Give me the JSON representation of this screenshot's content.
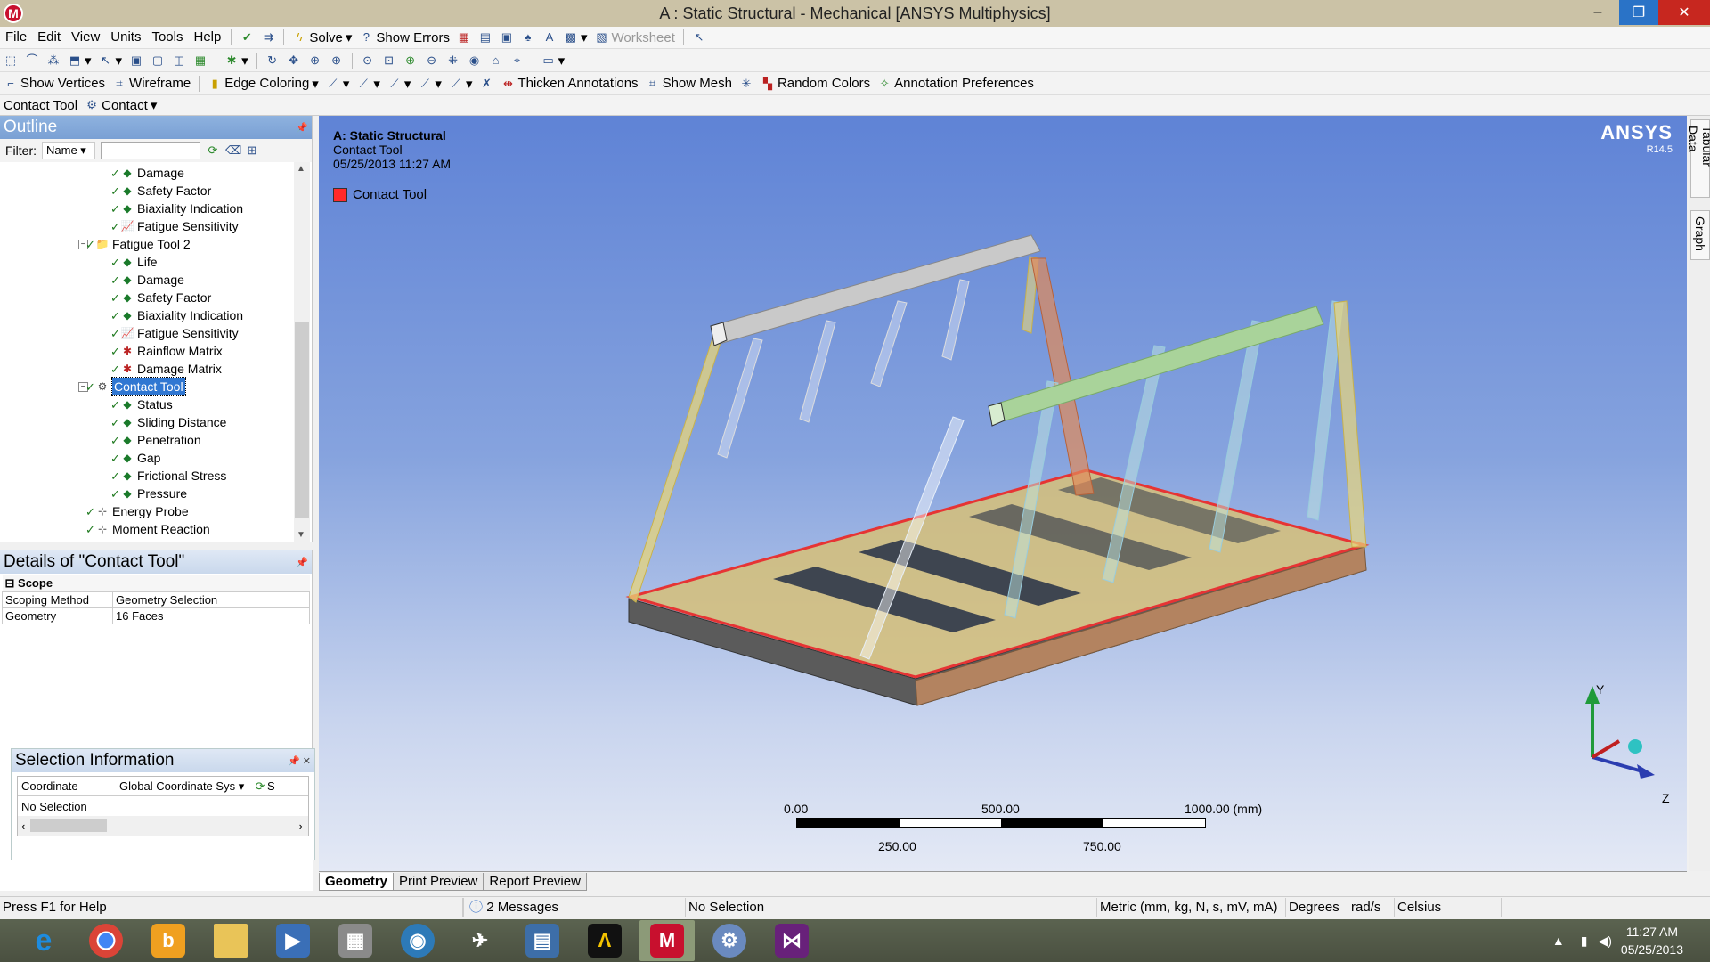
{
  "window": {
    "title": "A : Static Structural - Mechanical [ANSYS Multiphysics]",
    "logo": "M",
    "minimize": "–",
    "maximize": "❐",
    "close": "✕"
  },
  "menu": [
    "File",
    "Edit",
    "View",
    "Units",
    "Tools",
    "Help"
  ],
  "toolbar1": {
    "solve": "Solve",
    "show_errors": "Show Errors",
    "worksheet": "Worksheet"
  },
  "toolbar3": {
    "show_vertices": "Show Vertices",
    "wireframe": "Wireframe",
    "edge_coloring": "Edge Coloring",
    "thicken": "Thicken Annotations",
    "show_mesh": "Show Mesh",
    "random_colors": "Random Colors",
    "annotation_prefs": "Annotation Preferences"
  },
  "context": {
    "tool": "Contact Tool",
    "dropdown": "Contact"
  },
  "outline": {
    "title": "Outline",
    "filter_label": "Filter:",
    "filter_value": "Name",
    "items": [
      {
        "label": "Damage",
        "level": 2
      },
      {
        "label": "Safety Factor",
        "level": 2
      },
      {
        "label": "Biaxiality Indication",
        "level": 2
      },
      {
        "label": "Fatigue Sensitivity",
        "level": 2
      },
      {
        "label": "Fatigue Tool 2",
        "level": 1
      },
      {
        "label": "Life",
        "level": 2
      },
      {
        "label": "Damage",
        "level": 2
      },
      {
        "label": "Safety Factor",
        "level": 2
      },
      {
        "label": "Biaxiality Indication",
        "level": 2
      },
      {
        "label": "Fatigue Sensitivity",
        "level": 2
      },
      {
        "label": "Rainflow Matrix",
        "level": 2
      },
      {
        "label": "Damage Matrix",
        "level": 2
      },
      {
        "label": "Contact Tool",
        "level": 1
      },
      {
        "label": "Status",
        "level": 2
      },
      {
        "label": "Sliding Distance",
        "level": 2
      },
      {
        "label": "Penetration",
        "level": 2
      },
      {
        "label": "Gap",
        "level": 2
      },
      {
        "label": "Frictional Stress",
        "level": 2
      },
      {
        "label": "Pressure",
        "level": 2
      },
      {
        "label": "Energy Probe",
        "level": 1
      },
      {
        "label": "Moment Reaction",
        "level": 1
      }
    ]
  },
  "details": {
    "title": "Details of \"Contact Tool\"",
    "category": "Scope",
    "rows": [
      [
        "Scoping Method",
        "Geometry Selection"
      ],
      [
        "Geometry",
        "16 Faces"
      ]
    ]
  },
  "selection": {
    "title": "Selection Information",
    "coord_label": "Coordinate",
    "coord_value": "Global Coordinate Sys",
    "col2": "S",
    "status": "No Selection"
  },
  "viewport": {
    "analysis": "A: Static Structural",
    "object": "Contact Tool",
    "datetime": "05/25/2013 11:27 AM",
    "legend": "Contact Tool",
    "brand": "ANSYS",
    "version": "R14.5",
    "scale": {
      "t0": "0.00",
      "t500": "500.00",
      "t1000": "1000.00 (mm)",
      "t250": "250.00",
      "t750": "750.00"
    },
    "axes": {
      "x": "",
      "y": "Y",
      "z": "Z"
    },
    "tabs": [
      "Geometry",
      "Print Preview",
      "Report Preview"
    ]
  },
  "side_tabs": [
    "Tabular Data",
    "Graph"
  ],
  "status": {
    "help": "Press F1 for Help",
    "messages": "2 Messages",
    "selection": "No Selection",
    "units": "Metric (mm, kg, N, s, mV, mA)",
    "angle": "Degrees",
    "rate": "rad/s",
    "temp": "Celsius"
  },
  "clock": {
    "time": "11:27 AM",
    "date": "05/25/2013"
  },
  "colors": {
    "contact": "#ff2a2a",
    "select": "#3077d2",
    "viewport_top": "#5f83d6"
  }
}
